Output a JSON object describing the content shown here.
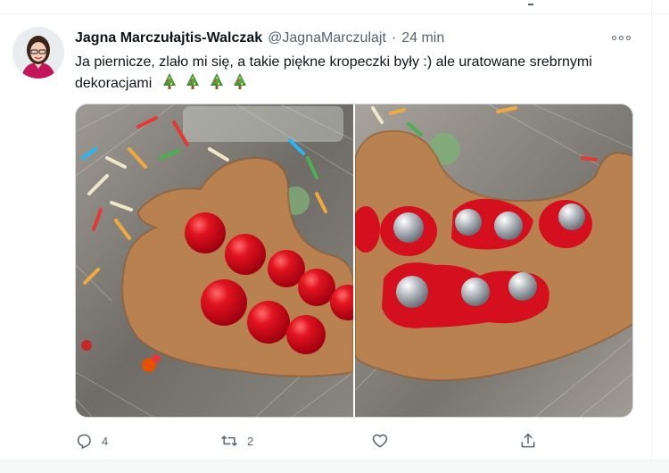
{
  "tweet": {
    "author_name": "Jagna Marczułajtis-Walczak",
    "handle": "@JagnaMarczulajt",
    "separator": "·",
    "time": "24 min",
    "text": "Ja piernicze, zlało mi się, a takie piękne kropeczki były :) ale uratowane srebrnymi dekoracjami",
    "emoji": [
      "christmas-tree",
      "christmas-tree",
      "christmas-tree",
      "christmas-tree"
    ],
    "media": [
      {
        "description_icon": "gingerbread-duck-red-dots-photo"
      },
      {
        "description_icon": "gingerbread-cookie-silver-pearls-photo"
      }
    ],
    "actions": {
      "reply_count": "4",
      "retweet_count": "2",
      "like_count": "",
      "share_icon": "share-icon"
    }
  },
  "colors": {
    "text_primary": "#0f1419",
    "text_secondary": "#536471",
    "border": "#cfd9de",
    "icing_red": "#d4101e",
    "cookie": "#b9814f"
  }
}
